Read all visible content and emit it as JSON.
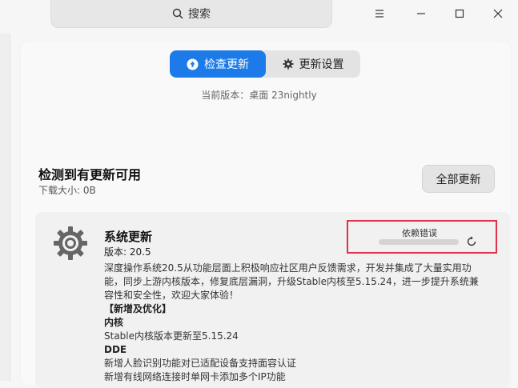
{
  "search": {
    "placeholder": "搜索"
  },
  "window_controls": [
    "menu-icon",
    "minimize-icon",
    "maximize-icon",
    "close-icon"
  ],
  "tabs": [
    {
      "label": "检查更新",
      "icon": "arrow-up-circle-icon",
      "active": true
    },
    {
      "label": "更新设置",
      "icon": "gear-icon",
      "active": false
    }
  ],
  "current_version": "当前版本：桌面 23nightly",
  "updates": {
    "title": "检测到有更新可用",
    "download_size": "下载大小: 0B",
    "update_all_label": "全部更新"
  },
  "item": {
    "title": "系统更新",
    "version": "版本: 20.5",
    "status": "依赖错误",
    "progress": 0,
    "desc_lines": [
      "深度操作系统20.5从功能层面上积极响应社区用户反馈需求，开发并集成了大量实用功能，同步上游内核版本，修复底层漏洞，升级Stable内核至5.15.24，进一步提升系统兼容性和安全性，欢迎大家体验！",
      "【新增及优化】",
      "内核",
      "Stable内核版本更新至5.15.24",
      "DDE",
      "新增人脸识别功能对已适配设备支持面容认证",
      "新增有线网络连接时单网卡添加多个IP功能"
    ]
  },
  "colors": {
    "accent": "#1c7be8",
    "highlight_border": "#e0304a"
  }
}
